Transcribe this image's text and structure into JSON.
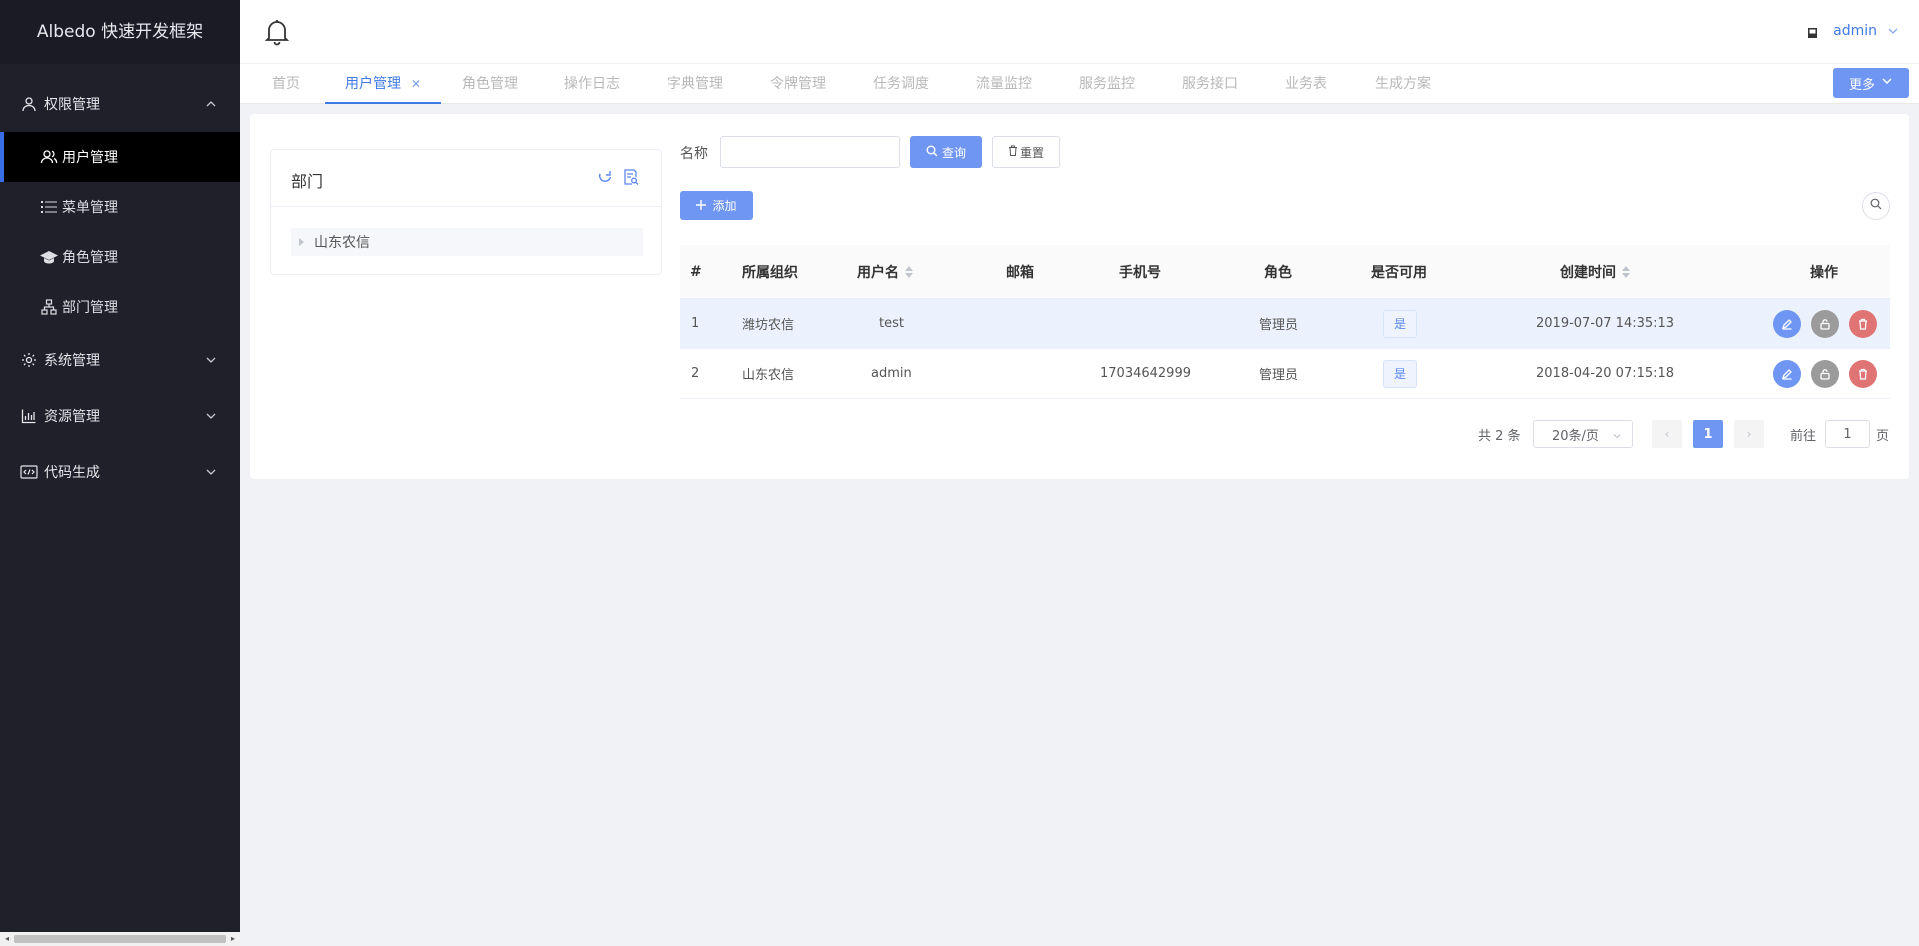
{
  "app": {
    "title": "Albedo 快速开发框架"
  },
  "sidebar": {
    "groups": [
      {
        "label": "权限管理",
        "icon": "user-outline-icon",
        "expanded": true,
        "items": [
          {
            "label": "用户管理",
            "icon": "users-icon",
            "active": true
          },
          {
            "label": "菜单管理",
            "icon": "list-icon"
          },
          {
            "label": "角色管理",
            "icon": "graduation-cap-icon"
          },
          {
            "label": "部门管理",
            "icon": "org-chart-icon"
          }
        ]
      },
      {
        "label": "系统管理",
        "icon": "gear-icon",
        "expanded": false
      },
      {
        "label": "资源管理",
        "icon": "bar-chart-icon",
        "expanded": false
      },
      {
        "label": "代码生成",
        "icon": "code-icon",
        "expanded": false
      }
    ]
  },
  "header": {
    "user": "admin"
  },
  "tabs": {
    "items": [
      "首页",
      "用户管理",
      "角色管理",
      "操作日志",
      "字典管理",
      "令牌管理",
      "任务调度",
      "流量监控",
      "服务监控",
      "服务接口",
      "业务表",
      "生成方案"
    ],
    "active": "用户管理",
    "more_label": "更多"
  },
  "dept": {
    "title": "部门",
    "tree_root": "山东农信"
  },
  "search": {
    "label": "名称",
    "value": "",
    "query_label": "查询",
    "reset_label": "重置",
    "add_label": "添加"
  },
  "table": {
    "columns": [
      "#",
      "所属组织",
      "用户名",
      "邮箱",
      "手机号",
      "角色",
      "是否可用",
      "创建时间",
      "操作"
    ],
    "rows": [
      {
        "index": "1",
        "org": "潍坊农信",
        "username": "test",
        "email": "",
        "phone": "",
        "role": "管理员",
        "enabled": "是",
        "created": "2019-07-07 14:35:13"
      },
      {
        "index": "2",
        "org": "山东农信",
        "username": "admin",
        "email": "",
        "phone": "17034642999",
        "role": "管理员",
        "enabled": "是",
        "created": "2018-04-20 07:15:18"
      }
    ]
  },
  "pagination": {
    "total_text": "共 2 条",
    "page_size": "20条/页",
    "current_page": "1",
    "goto_label": "前往",
    "goto_value": "1",
    "page_suffix": "页"
  },
  "colors": {
    "primary": "#6f96f2",
    "sidebar_bg": "#1f2029",
    "danger": "#e07474",
    "neutral": "#9b9b9b"
  }
}
